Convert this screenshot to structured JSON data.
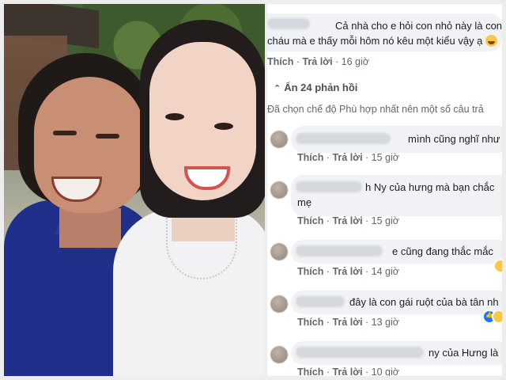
{
  "photo": {
    "alt": "selfie"
  },
  "comments": {
    "top": {
      "text_line1": "Cả nhà cho e hỏi con nhỏ này là con",
      "text_line2": "cháu mà e thấy mỗi hôm nó kêu một kiểu vậy ạ",
      "emoji": "laughing-face-icon",
      "like": "Thích",
      "reply": "Trả lời",
      "time": "16 giờ"
    },
    "hide_replies": "Ẩn 24 phản hồi",
    "sort_note": "Đã chọn chế độ Phù hợp nhất nên một số câu trả",
    "replies": [
      {
        "text": "mình cũng nghĩ như",
        "like": "Thích",
        "reply": "Trả lời",
        "time": "15 giờ"
      },
      {
        "author_visible": "h",
        "text": "Ny của hưng mà bạn chắc",
        "text_line2": "mẹ",
        "like": "Thích",
        "reply": "Trả lời",
        "time": "15 giờ"
      },
      {
        "text": "e cũng đang thắc mắc",
        "like": "Thích",
        "reply": "Trả lời",
        "time": "14 giờ"
      },
      {
        "text": "đây là con gái ruột của bà tân nh",
        "like": "Thích",
        "reply": "Trả lời",
        "time": "13 giờ"
      },
      {
        "text": "ny của Hưng là",
        "like": "Thích",
        "reply": "Trả lời",
        "time": "10 giờ"
      }
    ]
  },
  "colors": {
    "bubble": "#f0f2f5",
    "meta": "#606770",
    "text": "#1c1e21",
    "shirt_blue": "#1f2f8a"
  }
}
